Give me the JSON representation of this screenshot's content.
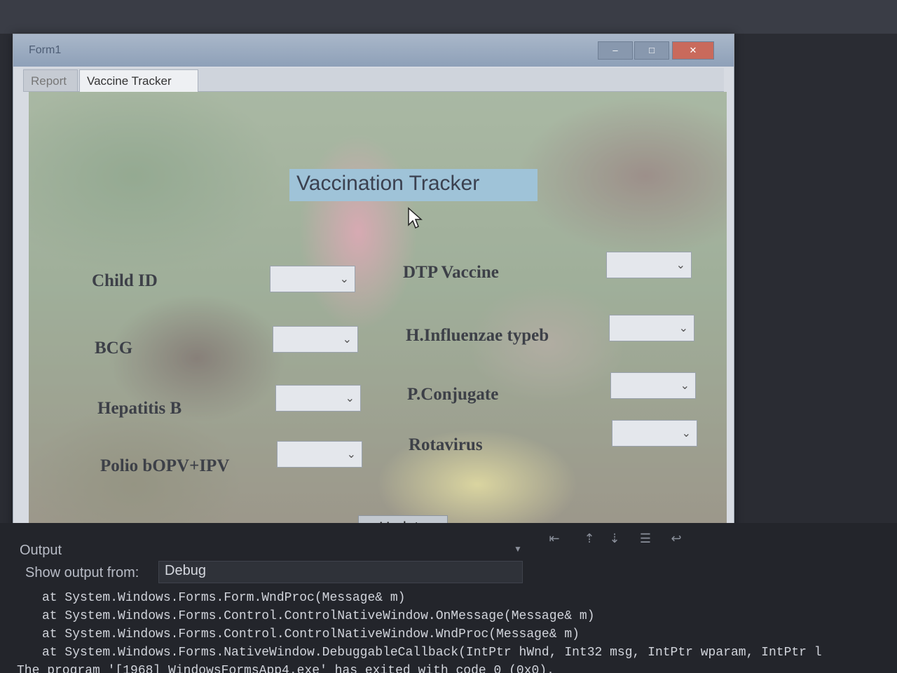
{
  "form": {
    "title": "Form1",
    "window_buttons": {
      "minimize": "–",
      "maximize": "□",
      "close": "✕"
    },
    "tabs": [
      {
        "label": "Report"
      },
      {
        "label": "Vaccine Tracker"
      }
    ],
    "heading": "Vaccination Tracker",
    "fields_left": [
      {
        "label": "Child ID"
      },
      {
        "label": "BCG"
      },
      {
        "label": "Hepatitis B"
      },
      {
        "label": "Polio bOPV+IPV"
      }
    ],
    "fields_right": [
      {
        "label": "DTP Vaccine"
      },
      {
        "label": "H.Influenzae typeb"
      },
      {
        "label": "P.Conjugate"
      },
      {
        "label": "Rotavirus"
      }
    ],
    "update_button": "Update"
  },
  "output": {
    "title": "Output",
    "show_label": "Show output from:",
    "source": "Debug",
    "lines": [
      "at System.Windows.Forms.Form.WndProc(Message& m)",
      "at System.Windows.Forms.Control.ControlNativeWindow.OnMessage(Message& m)",
      "at System.Windows.Forms.Control.ControlNativeWindow.WndProc(Message& m)",
      "at System.Windows.Forms.NativeWindow.DebuggableCallback(IntPtr hWnd, Int32 msg, IntPtr wparam, IntPtr l",
      "The program '[1968] WindowsFormsApp4.exe' has exited with code 0 (0x0)."
    ]
  },
  "icons": {
    "combo_chevron": "chevron-down-icon",
    "cursor": "mouse-pointer-icon"
  }
}
